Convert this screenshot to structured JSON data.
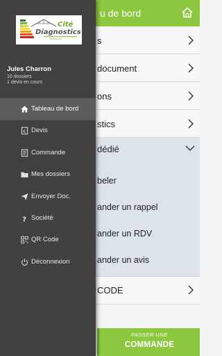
{
  "colors": {
    "accent": "#8dc63f",
    "drawer": "#414141",
    "drawer_active": "#5c5c5c",
    "expanded_bg": "#dce3ea"
  },
  "main": {
    "title": "u de bord",
    "home_icon": "home-icon",
    "rows": [
      {
        "label": "s"
      },
      {
        "label": "document"
      },
      {
        "label": "ons"
      },
      {
        "label": "stics"
      }
    ],
    "expanded": {
      "label": "dédié",
      "items": [
        "beler",
        "ander un rappel",
        "ander un RDV",
        "ander un avis"
      ]
    },
    "qr_row": {
      "label": "CODE"
    },
    "order_button": {
      "line1": "PASSER UNE",
      "line2": "COMMANDE"
    }
  },
  "drawer": {
    "logo": {
      "text_top": "Cité",
      "text_main": "Diagnostics"
    },
    "user": {
      "name": "Jules Charron",
      "dossiers": "10 dossiers",
      "devis": "1 devis en cours"
    },
    "nav": [
      {
        "label": "Tableau de bord",
        "icon": "home-icon",
        "active": true
      },
      {
        "label": "Devis",
        "icon": "devis-icon",
        "active": false
      },
      {
        "label": "Commande",
        "icon": "order-list-icon",
        "active": false
      },
      {
        "label": "Mes dossiers",
        "icon": "folder-icon",
        "active": false
      },
      {
        "label": "Envoyer Doc.",
        "icon": "send-icon",
        "active": false
      },
      {
        "label": "Société",
        "icon": "question-icon",
        "active": false
      },
      {
        "label": "QR Code",
        "icon": "qr-code-icon",
        "active": false
      },
      {
        "label": "Déconnexion",
        "icon": "power-icon",
        "active": false
      }
    ]
  }
}
